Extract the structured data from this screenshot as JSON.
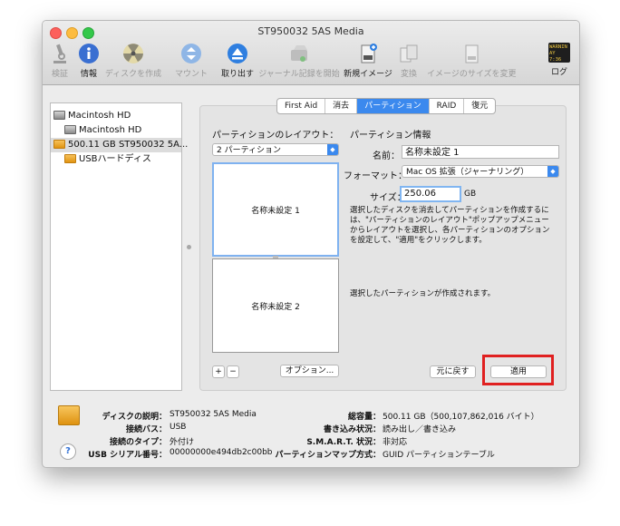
{
  "window": {
    "title": "ST950032 5AS Media"
  },
  "toolbar": {
    "verify": "検証",
    "info": "情報",
    "burn": "ディスクを作成",
    "mount": "マウント",
    "eject": "取り出す",
    "journal": "ジャーナル記録を開始",
    "new_image": "新規イメージ",
    "convert": "変換",
    "resize_image": "イメージのサイズを変更",
    "log": "ログ",
    "log_icon_text1": "WARNIN",
    "log_icon_text2": "AY 7:36"
  },
  "sidebar": {
    "items": [
      {
        "label": "Macintosh HD"
      },
      {
        "label": "Macintosh HD"
      },
      {
        "label": "500.11 GB ST950032 5A..."
      },
      {
        "label": "USBハードディス"
      }
    ]
  },
  "tabs": [
    {
      "label": "First Aid"
    },
    {
      "label": "消去"
    },
    {
      "label": "パーティション"
    },
    {
      "label": "RAID"
    },
    {
      "label": "復元"
    }
  ],
  "partition": {
    "layout_heading": "パーティションのレイアウト：",
    "info_heading": "パーティション情報",
    "layout_value": "2 パーティション",
    "name_label": "名前：",
    "name_value": "名称未設定 1",
    "format_label": "フォーマット：",
    "format_value": "Mac OS 拡張（ジャーナリング）",
    "size_label": "サイズ：",
    "size_value": "250.06",
    "size_unit": "GB",
    "description": "選択したディスクを消去してパーティションを作成するには、\"パーティションのレイアウト\"ポップアップメニューからレイアウトを選択し、各パーティションのオプションを設定して、\"適用\"をクリックします。",
    "status": "選択したパーティションが作成されます。",
    "part1": "名称未設定 1",
    "part2": "名称未設定 2",
    "add": "+",
    "remove": "−",
    "options": "オプション...",
    "revert": "元に戻す",
    "apply": "適用"
  },
  "info": {
    "desc_key": "ディスクの説明：",
    "desc_val": "ST950032 5AS Media",
    "bus_key": "接続バス：",
    "bus_val": "USB",
    "type_key": "接続のタイプ：",
    "type_val": "外付け",
    "serial_key": "USB シリアル番号：",
    "serial_val": "00000000e494db2c00bb",
    "cap_key": "総容量：",
    "cap_val": "500.11 GB（500,107,862,016 バイト）",
    "write_key": "書き込み状況：",
    "write_val": "読み出し／書き込み",
    "smart_key": "S.M.A.R.T. 状況：",
    "smart_val": "非対応",
    "map_key": "パーティションマップ方式：",
    "map_val": "GUID パーティションテーブル"
  },
  "help": "?",
  "colors": {
    "accent": "#3b89ee",
    "highlight_box": "#e02020"
  }
}
